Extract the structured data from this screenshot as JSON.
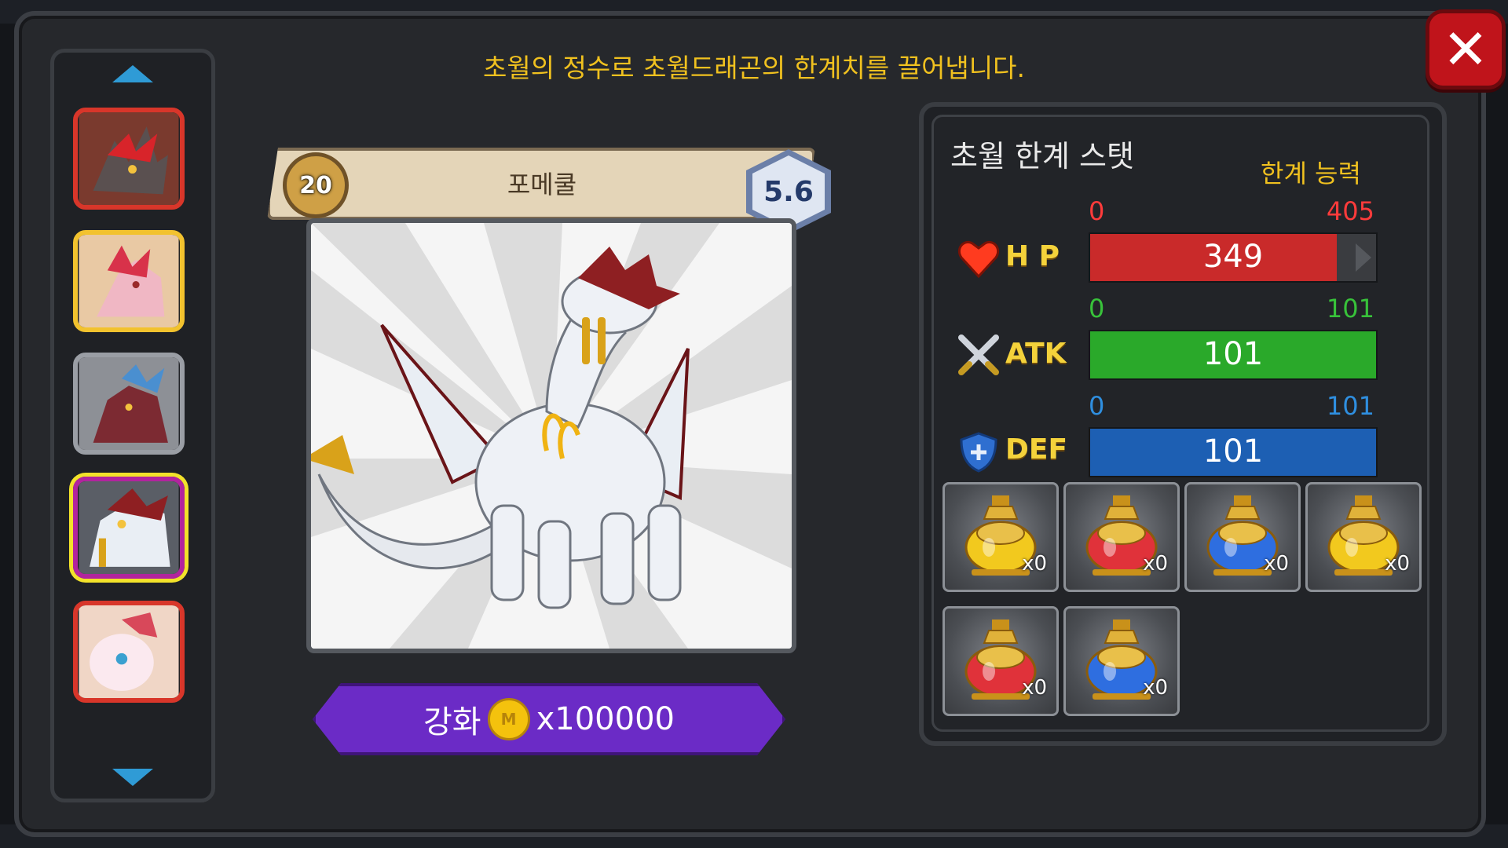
{
  "title": "초월의 정수로 초월드래곤의 한계치를 끌어냅니다.",
  "close": {
    "icon": "close-icon",
    "color": "#c0141b"
  },
  "dragon_list": [
    {
      "name": "dragon-thumb-1",
      "border": "#d8362a"
    },
    {
      "name": "dragon-thumb-2",
      "border": "#f2c22e"
    },
    {
      "name": "dragon-thumb-3",
      "border": "#9a9ea5"
    },
    {
      "name": "dragon-thumb-4",
      "border": "#b2249e",
      "selected": true
    },
    {
      "name": "dragon-thumb-5",
      "border": "#d8362a"
    }
  ],
  "dragon": {
    "level": "20",
    "name": "포메쿨",
    "grade": "5.6"
  },
  "upgrade": {
    "label": "강화",
    "cost": "x100000"
  },
  "stats": {
    "title": "초월 한계 스탯",
    "limit_label": "한계 능력",
    "hp": {
      "label": "H P",
      "min": "0",
      "max": "405",
      "value": "349",
      "min_color": "#ff3b3b",
      "max_color": "#ff3b3b",
      "bar_color": "#c92a2a"
    },
    "atk": {
      "label": "ATK",
      "min": "0",
      "max": "101",
      "value": "101",
      "min_color": "#38c23a",
      "max_color": "#38c23a",
      "bar_color": "#2aa92a"
    },
    "def": {
      "label": "DEF",
      "min": "0",
      "max": "101",
      "value": "101",
      "min_color": "#2f8fe0",
      "max_color": "#2f8fe0",
      "bar_color": "#1d5fb3"
    }
  },
  "potions": [
    {
      "color": "#f2c91e",
      "count": "x0"
    },
    {
      "color": "#e0323a",
      "count": "x0"
    },
    {
      "color": "#2e6ee0",
      "count": "x0"
    },
    {
      "color": "#f2c91e",
      "count": "x0"
    },
    {
      "color": "#e0323a",
      "count": "x0"
    },
    {
      "color": "#2e6ee0",
      "count": "x0"
    }
  ]
}
